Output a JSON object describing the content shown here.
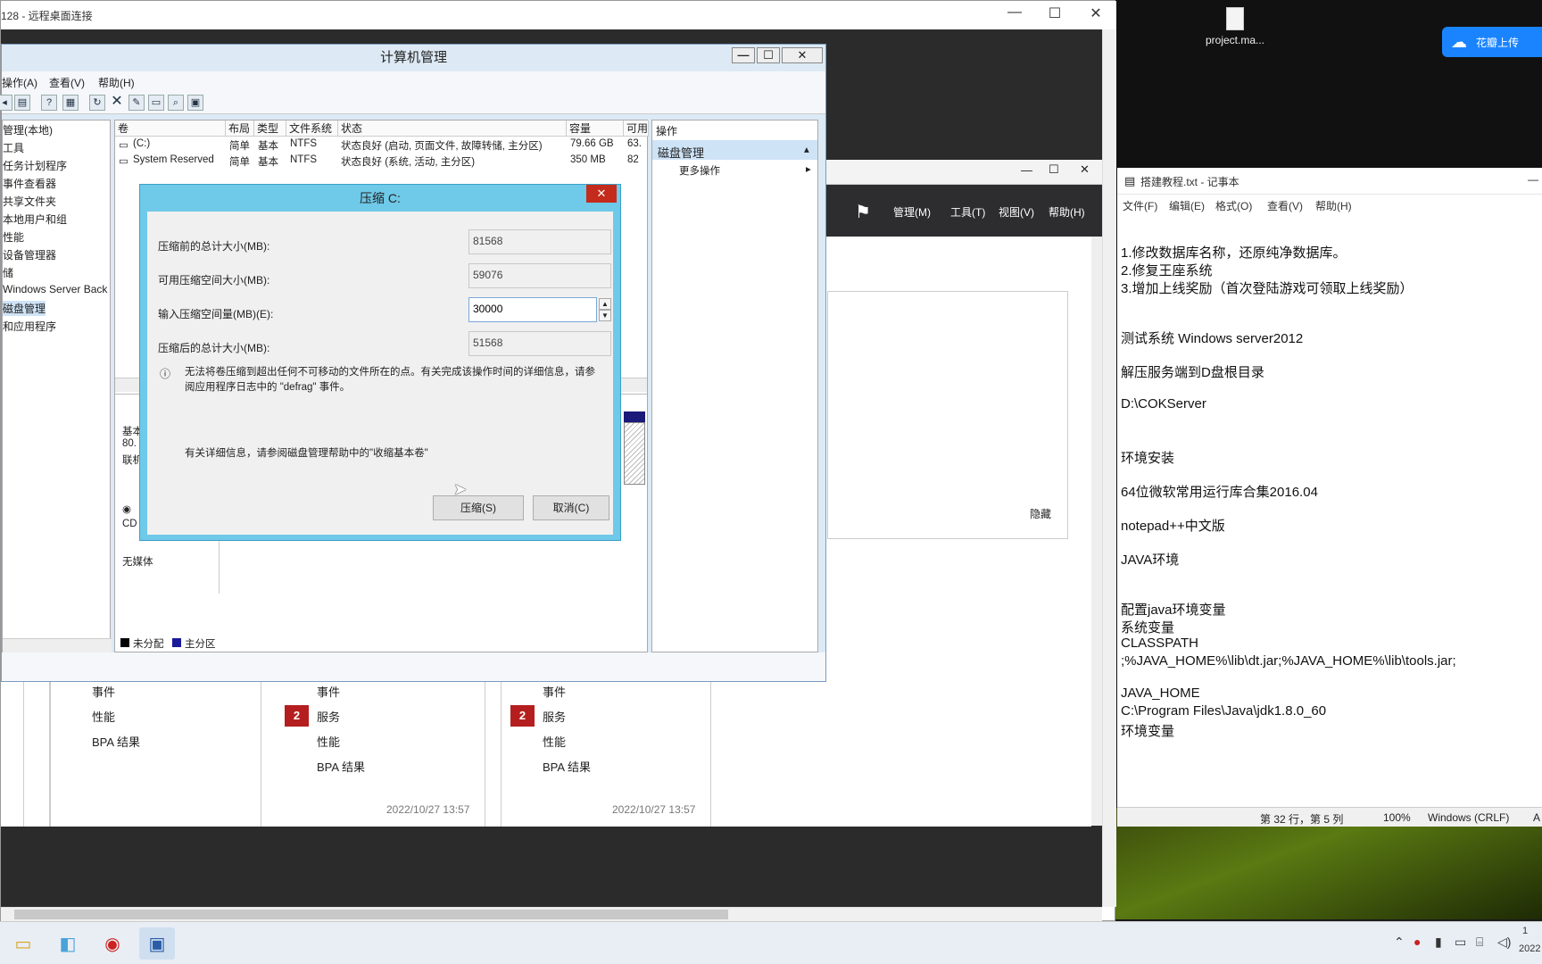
{
  "rdp": {
    "title": "128 - 远程桌面连接",
    "min": "—",
    "max": "☐",
    "close": "✕"
  },
  "desktop": {
    "file_label": "project.ma...",
    "upload_label": "花瓣上传"
  },
  "computer_management": {
    "title": "计算机管理",
    "menu": [
      "操作(A)",
      "查看(V)",
      "帮助(H)"
    ],
    "tree": [
      "管理(本地)",
      "工具",
      "任务计划程序",
      "事件查看器",
      "共享文件夹",
      "本地用户和组",
      "性能",
      "设备管理器",
      "储",
      "Windows Server Back",
      "磁盘管理",
      "和应用程序"
    ],
    "columns": [
      "卷",
      "布局",
      "类型",
      "文件系统",
      "状态",
      "容量",
      "可用"
    ],
    "rows": [
      {
        "vol": "(C:)",
        "layout": "简单",
        "type": "基本",
        "fs": "NTFS",
        "status": "状态良好 (启动, 页面文件, 故障转储, 主分区)",
        "cap": "79.66 GB",
        "free": "63."
      },
      {
        "vol": "System Reserved",
        "layout": "简单",
        "type": "基本",
        "fs": "NTFS",
        "status": "状态良好 (系统, 活动, 主分区)",
        "cap": "350 MB",
        "free": "82"
      }
    ],
    "disk0_labels": [
      "基本",
      "80.",
      "联机"
    ],
    "cd_label": "CD",
    "no_media": "无媒体",
    "legend": [
      "未分配",
      "主分区"
    ],
    "actions_header": "操作",
    "actions_section": "磁盘管理",
    "actions_more": "更多操作"
  },
  "dialog": {
    "title": "压缩 C:",
    "close": "✕",
    "fields": [
      {
        "label": "压缩前的总计大小(MB):",
        "value": "81568"
      },
      {
        "label": "可用压缩空间大小(MB):",
        "value": "59076"
      },
      {
        "label": "输入压缩空间量(MB)(E):",
        "value": "30000"
      },
      {
        "label": "压缩后的总计大小(MB):",
        "value": "51568"
      }
    ],
    "note": "无法将卷压缩到超出任何不可移动的文件所在的点。有关完成该操作时间的详细信息，请参阅应用程序日志中的 \"defrag\" 事件。",
    "help": "有关详细信息，请参阅磁盘管理帮助中的\"收缩基本卷\"",
    "ok": "压缩(S)",
    "cancel": "取消(C)"
  },
  "server_manager": {
    "menu": [
      "管理(M)",
      "工具(T)",
      "视图(V)",
      "帮助(H)"
    ],
    "panel_link": "隐藏",
    "tiles": [
      {
        "items": [
          "事件",
          "性能",
          "BPA 结果"
        ]
      },
      {
        "badge": "2",
        "items": [
          "事件",
          "服务",
          "性能",
          "BPA 结果"
        ],
        "time": "2022/10/27 13:57"
      },
      {
        "badge": "2",
        "items": [
          "事件",
          "服务",
          "性能",
          "BPA 结果"
        ],
        "time": "2022/10/27 13:57"
      }
    ]
  },
  "notepad": {
    "title": "搭建教程.txt - 记事本",
    "menu": [
      "文件(F)",
      "编辑(E)",
      "格式(O)",
      "查看(V)",
      "帮助(H)"
    ],
    "lines": [
      "1.修改数据库名称，还原纯净数据库。",
      "2.修复王座系统",
      "3.增加上线奖励（首次登陆游戏可领取上线奖励）",
      "测试系统 Windows server2012",
      "解压服务端到D盘根目录",
      "D:\\COKServer",
      "环境安装",
      "64位微软常用运行库合集2016.04",
      "notepad++中文版",
      "JAVA环境",
      "配置java环境变量",
      "系统变量",
      "CLASSPATH",
      ";%JAVA_HOME%\\lib\\dt.jar;%JAVA_HOME%\\lib\\tools.jar;",
      "JAVA_HOME",
      "C:\\Program Files\\Java\\jdk1.8.0_60",
      "环境变量"
    ],
    "status": {
      "pos": "第 32 行，第 5 列",
      "zoom": "100%",
      "eol": "Windows (CRLF)",
      "enc": "A"
    }
  },
  "taskbar": {
    "clock_time": "1",
    "clock_date": "2022"
  }
}
